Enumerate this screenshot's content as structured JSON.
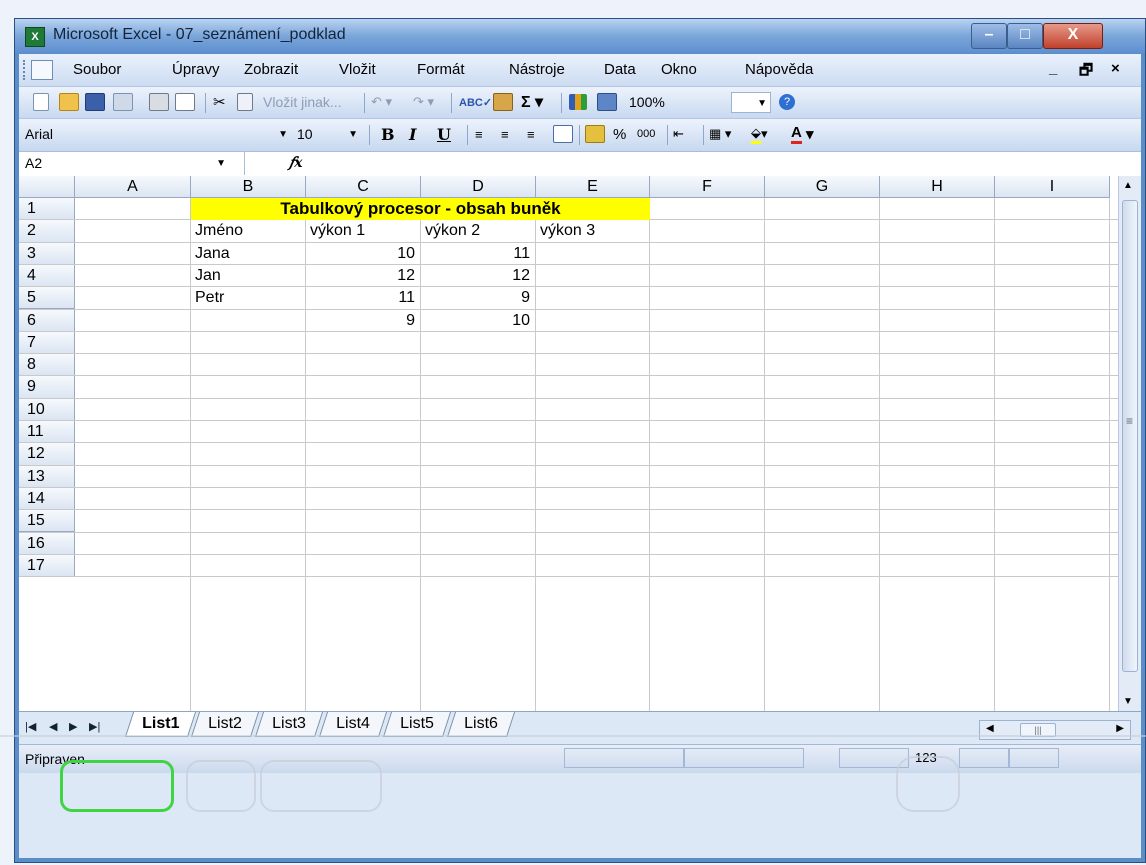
{
  "window": {
    "title": "Microsoft Excel - 07_seznámení_podklad",
    "app_icon": "excel-icon"
  },
  "menu": {
    "items": [
      "Soubor",
      "Úpravy",
      "Zobrazit",
      "Vložit",
      "Formát",
      "Nástroje",
      "Data",
      "Okno",
      "Nápověda"
    ],
    "mdi_controls": [
      "_",
      "🗗",
      "×"
    ]
  },
  "standard_toolbar": {
    "paste_special": "Vložit jinak...",
    "zoom": "100%"
  },
  "format_toolbar": {
    "font": "Arial",
    "size": "10",
    "bold": "B",
    "italic": "I",
    "underline": "U",
    "percent": "%",
    "thousands": "000",
    "font_color_letter": "A"
  },
  "formula_bar": {
    "name_box": "A2",
    "fx": "fx",
    "value": ""
  },
  "columns": [
    "A",
    "B",
    "C",
    "D",
    "E",
    "F",
    "G",
    "H",
    "I"
  ],
  "rows": [
    "1",
    "2",
    "3",
    "4",
    "5",
    "6",
    "7",
    "8",
    "9",
    "10",
    "11",
    "12",
    "13",
    "14",
    "15",
    "16",
    "17"
  ],
  "sheet": {
    "title": "Tabulkový procesor - obsah buněk",
    "headers": [
      "Jméno",
      "výkon 1",
      "výkon 2",
      "výkon 3"
    ],
    "data": [
      {
        "name": "Jana",
        "v1": "10",
        "v2": "11"
      },
      {
        "name": "Jan",
        "v1": "12",
        "v2": "12"
      },
      {
        "name": "Petr",
        "v1": "11",
        "v2": "9"
      },
      {
        "name": "",
        "v1": "9",
        "v2": "10"
      }
    ]
  },
  "tabs": [
    "List1",
    "List2",
    "List3",
    "List4",
    "List5",
    "List6"
  ],
  "status": {
    "text": "Připraven",
    "num": "123"
  },
  "colors": {
    "title_fill": "#ffff00",
    "highlight": "#3fd441"
  }
}
